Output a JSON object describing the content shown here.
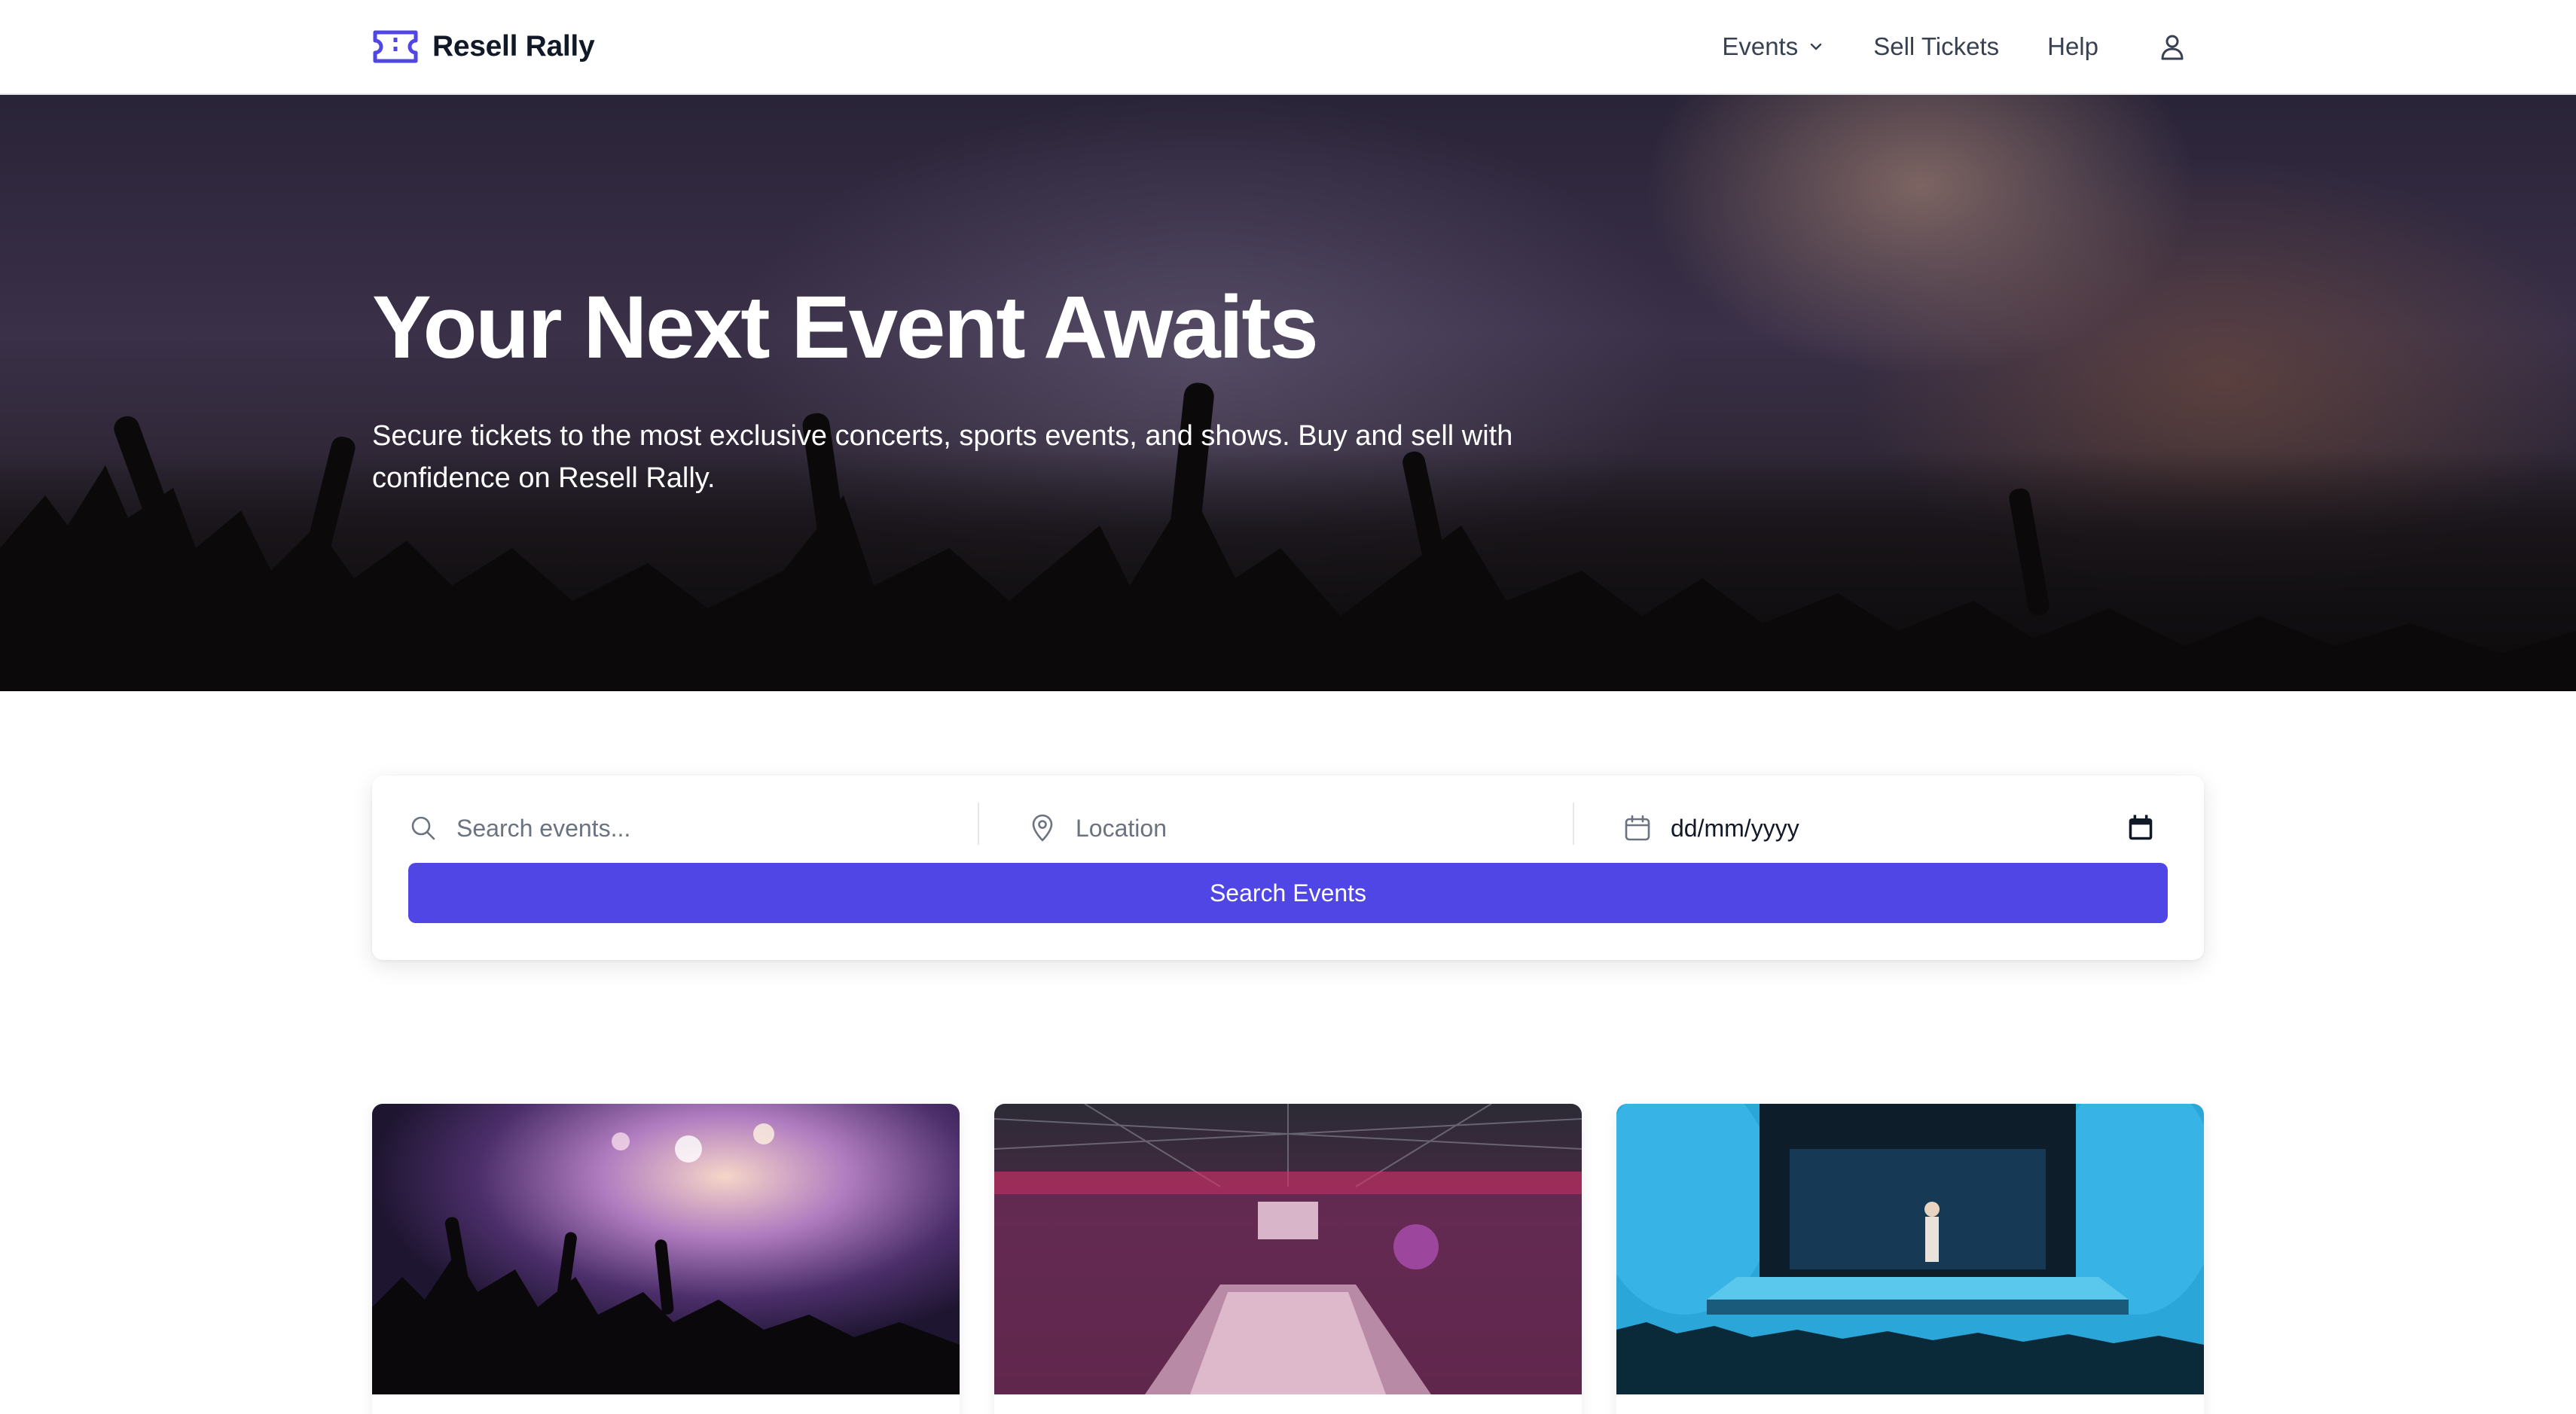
{
  "header": {
    "brand_name": "Resell Rally",
    "nav": {
      "events": "Events",
      "sell_tickets": "Sell Tickets",
      "help": "Help"
    }
  },
  "hero": {
    "title": "Your Next Event Awaits",
    "subtitle": "Secure tickets to the most exclusive concerts, sports events, and shows. Buy and sell with confidence on Resell Rally."
  },
  "search": {
    "query_placeholder": "Search events...",
    "location_placeholder": "Location",
    "date_value": "dd/mm/yyyy",
    "button_label": "Search Events"
  },
  "icons": {
    "brand": "ticket-icon",
    "nav_dropdown": "chevron-down-icon",
    "user": "user-icon",
    "search": "search-icon",
    "location": "map-pin-icon",
    "date": "calendar-icon"
  },
  "colors": {
    "accent": "#4f46e5",
    "text": "#111827",
    "muted": "#6b7280"
  },
  "cards": [
    {
      "image": "concert-crowd-photo"
    },
    {
      "image": "arena-photo"
    },
    {
      "image": "theater-stage-photo"
    }
  ]
}
